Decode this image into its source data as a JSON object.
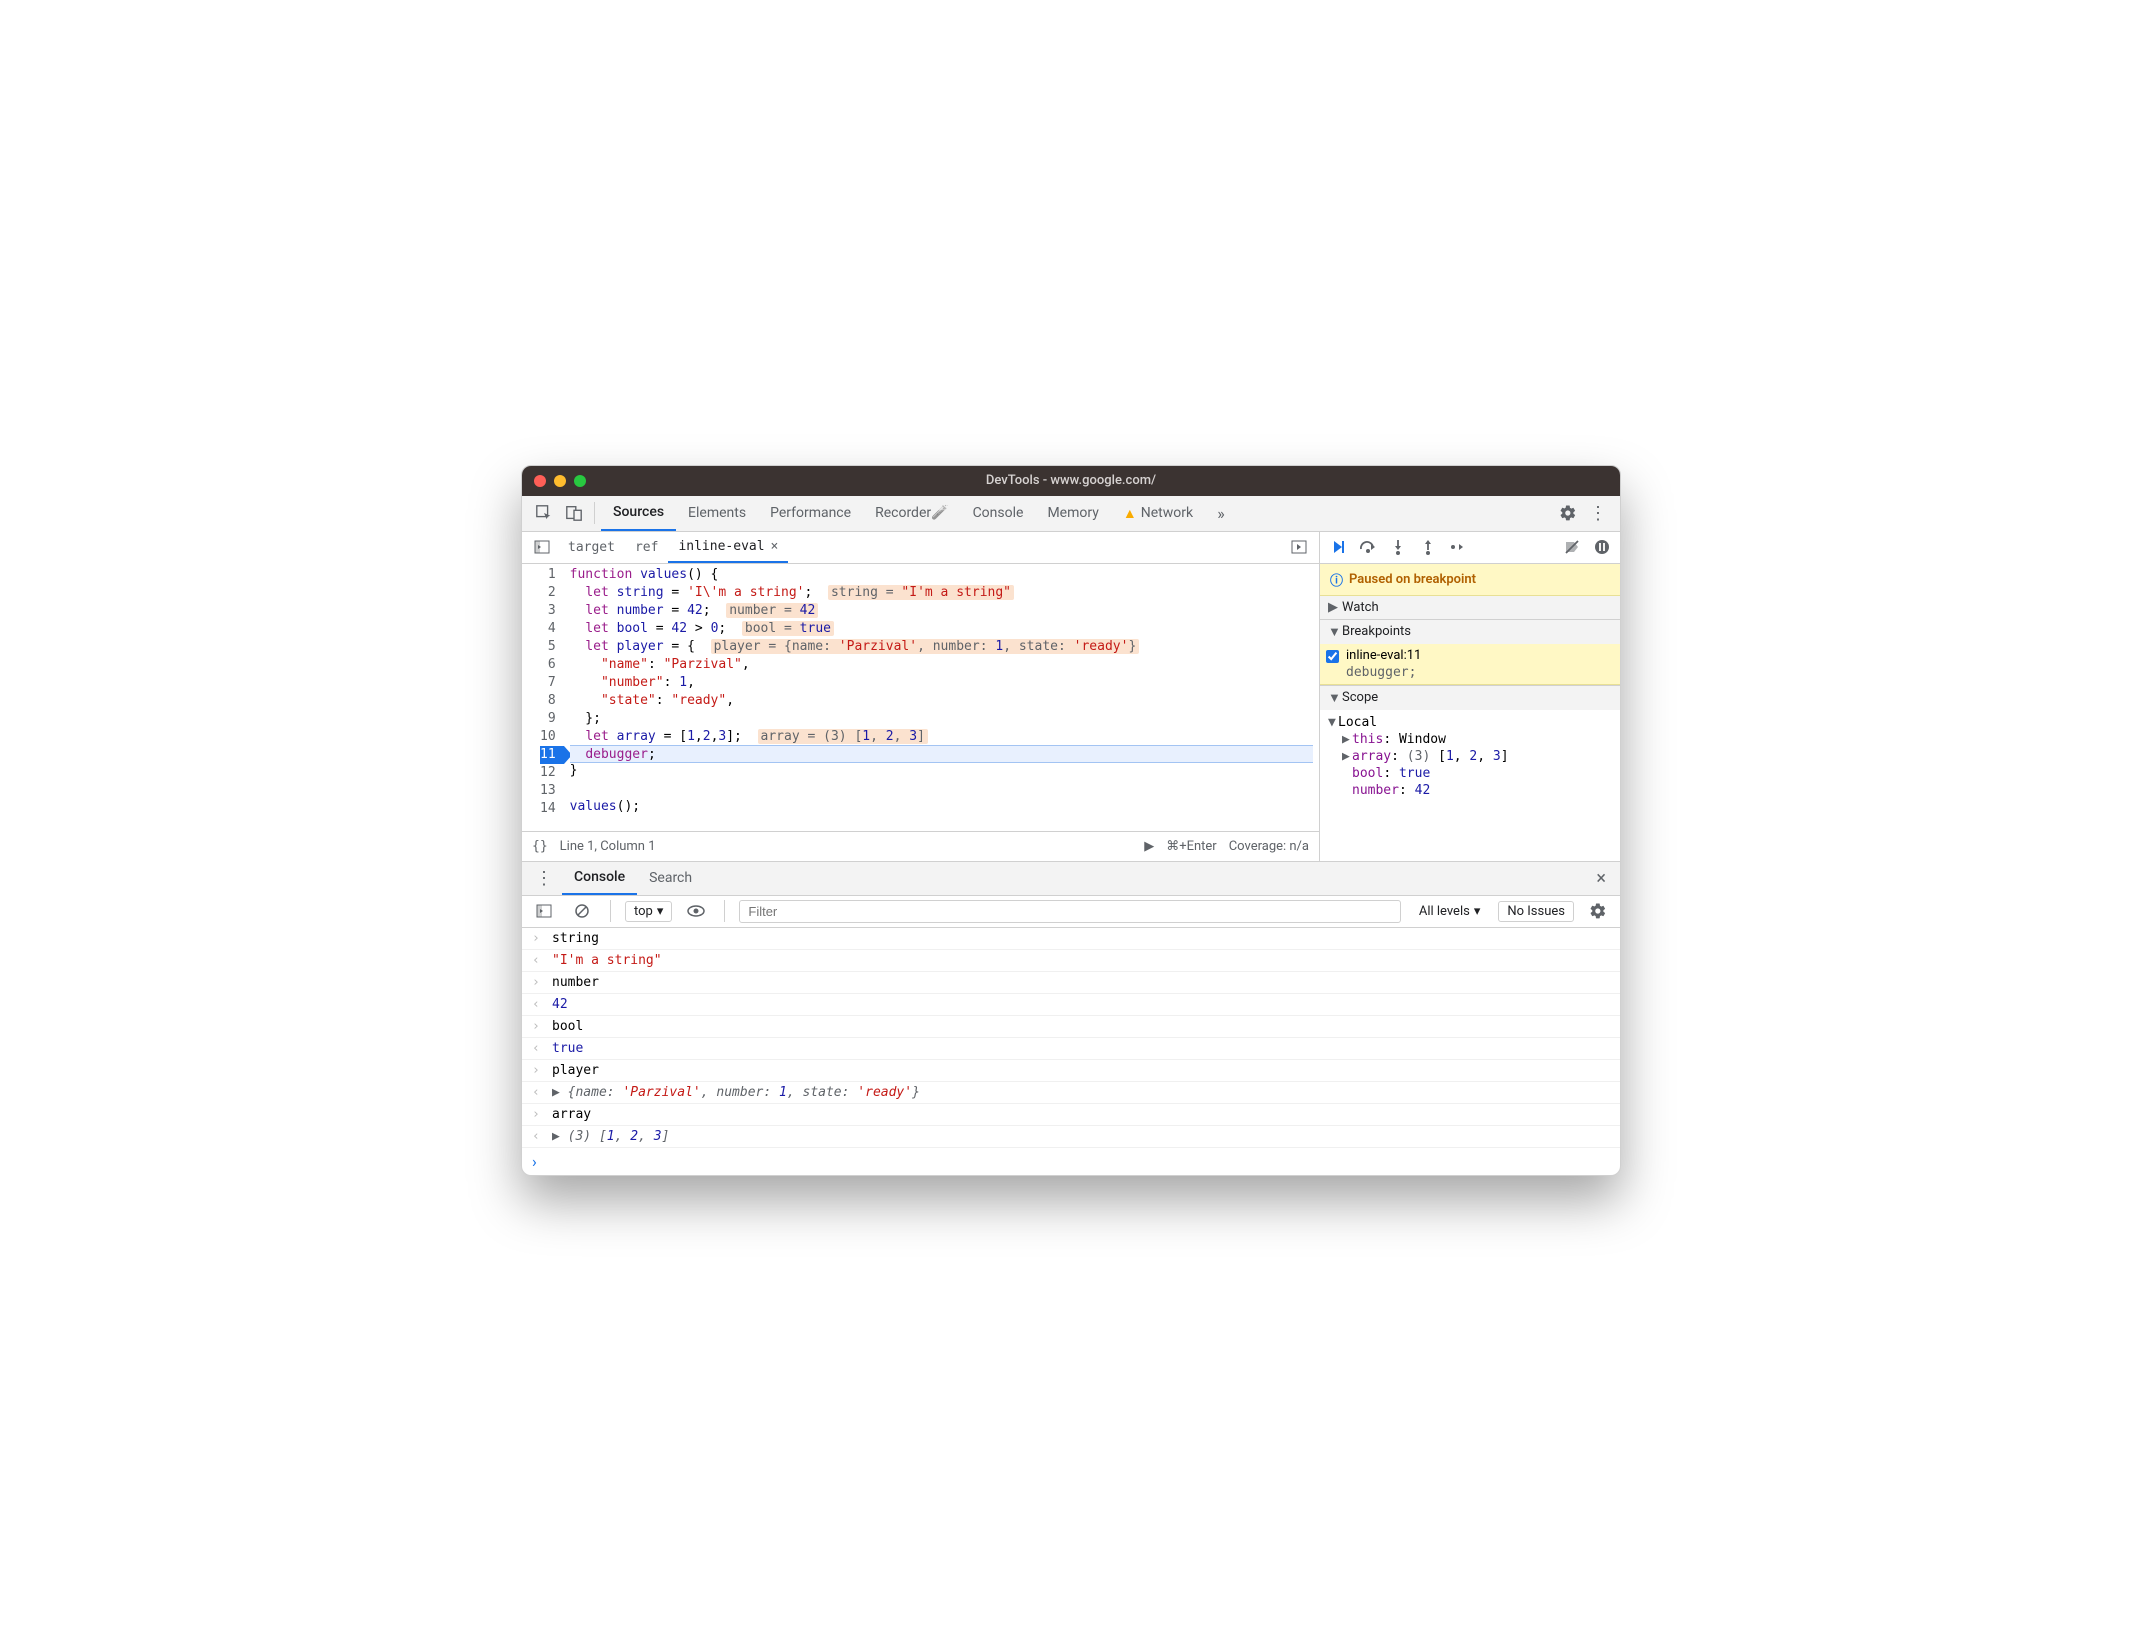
{
  "window": {
    "title": "DevTools - www.google.com/"
  },
  "tabs": {
    "items": [
      "Sources",
      "Elements",
      "Performance",
      "Recorder",
      "Console",
      "Memory",
      "Network"
    ],
    "active": 0,
    "warning_index": 6,
    "recorder_flask": true
  },
  "source_tabs": {
    "items": [
      "target",
      "ref",
      "inline-eval"
    ],
    "active": 2
  },
  "code": {
    "lines": [
      {
        "n": 1,
        "segs": [
          [
            "kw",
            "function"
          ],
          [
            "op",
            " "
          ],
          [
            "fn",
            "values"
          ],
          [
            "op",
            "() {"
          ]
        ]
      },
      {
        "n": 2,
        "segs": [
          [
            "op",
            "  "
          ],
          [
            "kw",
            "let"
          ],
          [
            "op",
            " "
          ],
          [
            "var",
            "string"
          ],
          [
            "op",
            " = "
          ],
          [
            "str",
            "'I\\'m a string'"
          ],
          [
            "op",
            ";"
          ]
        ],
        "hint": [
          [
            "hv-name",
            "string = "
          ],
          [
            "hv-str",
            "\"I'm a string\""
          ]
        ]
      },
      {
        "n": 3,
        "segs": [
          [
            "op",
            "  "
          ],
          [
            "kw",
            "let"
          ],
          [
            "op",
            " "
          ],
          [
            "var",
            "number"
          ],
          [
            "op",
            " = "
          ],
          [
            "num",
            "42"
          ],
          [
            "op",
            ";"
          ]
        ],
        "hint": [
          [
            "hv-name",
            "number = "
          ],
          [
            "hv-num",
            "42"
          ]
        ]
      },
      {
        "n": 4,
        "segs": [
          [
            "op",
            "  "
          ],
          [
            "kw",
            "let"
          ],
          [
            "op",
            " "
          ],
          [
            "var",
            "bool"
          ],
          [
            "op",
            " = "
          ],
          [
            "num",
            "42"
          ],
          [
            "op",
            " > "
          ],
          [
            "num",
            "0"
          ],
          [
            "op",
            ";"
          ]
        ],
        "hint": [
          [
            "hv-name",
            "bool = "
          ],
          [
            "hv-num",
            "true"
          ]
        ]
      },
      {
        "n": 5,
        "segs": [
          [
            "op",
            "  "
          ],
          [
            "kw",
            "let"
          ],
          [
            "op",
            " "
          ],
          [
            "var",
            "player"
          ],
          [
            "op",
            " = {"
          ]
        ],
        "hint": [
          [
            "hv-name",
            "player = {name: "
          ],
          [
            "hv-str",
            "'Parzival'"
          ],
          [
            "hv-name",
            ", number: "
          ],
          [
            "hv-num",
            "1"
          ],
          [
            "hv-name",
            ", state: "
          ],
          [
            "hv-str",
            "'ready'"
          ],
          [
            "hv-name",
            "}"
          ]
        ]
      },
      {
        "n": 6,
        "segs": [
          [
            "op",
            "    "
          ],
          [
            "prop",
            "\"name\""
          ],
          [
            "op",
            ": "
          ],
          [
            "str",
            "\"Parzival\""
          ],
          [
            "op",
            ","
          ]
        ]
      },
      {
        "n": 7,
        "segs": [
          [
            "op",
            "    "
          ],
          [
            "prop",
            "\"number\""
          ],
          [
            "op",
            ": "
          ],
          [
            "num",
            "1"
          ],
          [
            "op",
            ","
          ]
        ]
      },
      {
        "n": 8,
        "segs": [
          [
            "op",
            "    "
          ],
          [
            "prop",
            "\"state\""
          ],
          [
            "op",
            ": "
          ],
          [
            "str",
            "\"ready\""
          ],
          [
            "op",
            ","
          ]
        ]
      },
      {
        "n": 9,
        "segs": [
          [
            "op",
            "  };"
          ]
        ]
      },
      {
        "n": 10,
        "segs": [
          [
            "op",
            "  "
          ],
          [
            "kw",
            "let"
          ],
          [
            "op",
            " "
          ],
          [
            "var",
            "array"
          ],
          [
            "op",
            " = ["
          ],
          [
            "num",
            "1"
          ],
          [
            "op",
            ","
          ],
          [
            "num",
            "2"
          ],
          [
            "op",
            ","
          ],
          [
            "num",
            "3"
          ],
          [
            "op",
            "];"
          ]
        ],
        "hint": [
          [
            "hv-name",
            "array = (3) ["
          ],
          [
            "hv-num",
            "1"
          ],
          [
            "hv-name",
            ", "
          ],
          [
            "hv-num",
            "2"
          ],
          [
            "hv-name",
            ", "
          ],
          [
            "hv-num",
            "3"
          ],
          [
            "hv-name",
            "]"
          ]
        ]
      },
      {
        "n": 11,
        "bp": true,
        "hl": true,
        "segs": [
          [
            "op",
            "  "
          ],
          [
            "dbg",
            "debugger"
          ],
          [
            "op",
            ";"
          ]
        ]
      },
      {
        "n": 12,
        "segs": [
          [
            "op",
            "}"
          ]
        ]
      },
      {
        "n": 13,
        "segs": [
          [
            "op",
            ""
          ]
        ]
      },
      {
        "n": 14,
        "segs": [
          [
            "fn",
            "values"
          ],
          [
            "op",
            "();"
          ]
        ]
      }
    ]
  },
  "status_bar": {
    "cursor": "Line 1, Column 1",
    "run_hint": "⌘+Enter",
    "coverage": "Coverage: n/a"
  },
  "debugger": {
    "paused_msg": "Paused on breakpoint",
    "sections": {
      "watch": "Watch",
      "breakpoints": "Breakpoints",
      "scope": "Scope"
    },
    "breakpoint": {
      "label": "inline-eval:11",
      "sub": "debugger;"
    },
    "scope": {
      "local_label": "Local",
      "items": [
        {
          "tri": "▶",
          "name": "this",
          "val": "Window",
          "cls": "sc-val-obj"
        },
        {
          "tri": "▶",
          "name": "array",
          "raw": "(3) [1, 2, 3]"
        },
        {
          "tri": "",
          "name": "bool",
          "val": "true",
          "cls": "sc-val-num"
        },
        {
          "tri": "",
          "name": "number",
          "val": "42",
          "cls": "sc-val-num"
        }
      ]
    }
  },
  "drawer": {
    "tabs": [
      "Console",
      "Search"
    ],
    "active": 0
  },
  "console_toolbar": {
    "context": "top",
    "filter_placeholder": "Filter",
    "levels": "All levels",
    "issues": "No Issues"
  },
  "console_rows": [
    {
      "dir": "in",
      "type": "plain",
      "text": "string"
    },
    {
      "dir": "out",
      "type": "str",
      "text": "\"I'm a string\""
    },
    {
      "dir": "in",
      "type": "plain",
      "text": "number"
    },
    {
      "dir": "out",
      "type": "num",
      "text": "42"
    },
    {
      "dir": "in",
      "type": "plain",
      "text": "bool"
    },
    {
      "dir": "out",
      "type": "bool",
      "text": "true"
    },
    {
      "dir": "in",
      "type": "plain",
      "text": "player"
    },
    {
      "dir": "out",
      "type": "obj",
      "segs": [
        [
          "op",
          "▶ "
        ],
        [
          "it",
          "{name: "
        ],
        [
          "str",
          "'Parzival'"
        ],
        [
          "it",
          ", number: "
        ],
        [
          "num",
          "1"
        ],
        [
          "it",
          ", state: "
        ],
        [
          "str",
          "'ready'"
        ],
        [
          "it",
          "}"
        ]
      ]
    },
    {
      "dir": "in",
      "type": "plain",
      "text": "array"
    },
    {
      "dir": "out",
      "type": "arr",
      "segs": [
        [
          "op",
          "▶ "
        ],
        [
          "it",
          "(3) ["
        ],
        [
          "num",
          "1"
        ],
        [
          "it",
          ", "
        ],
        [
          "num",
          "2"
        ],
        [
          "it",
          ", "
        ],
        [
          "num",
          "3"
        ],
        [
          "it",
          "]"
        ]
      ]
    }
  ]
}
